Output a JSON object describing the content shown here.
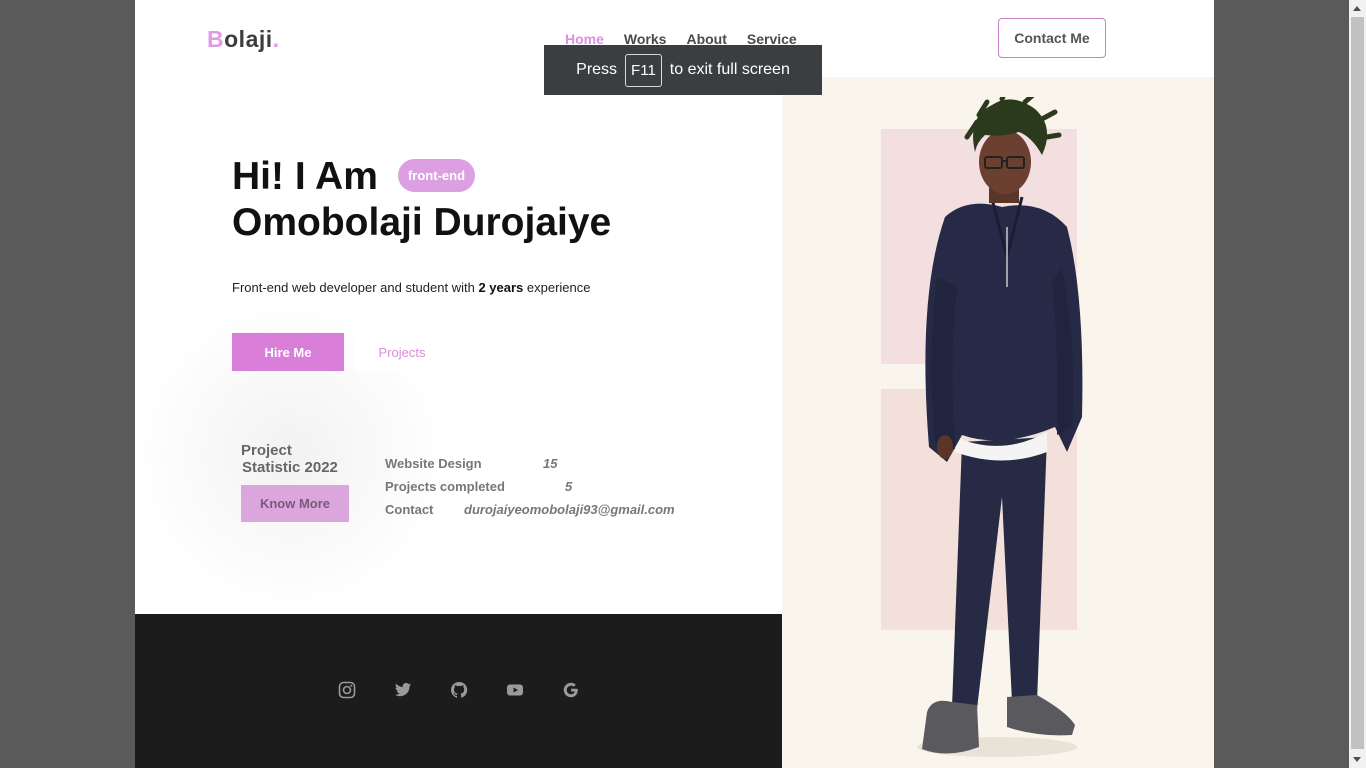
{
  "header": {
    "logo_first": "B",
    "logo_rest": "olaji",
    "logo_dot": ".",
    "nav": [
      "Home",
      "Works",
      "About",
      "Service"
    ],
    "contact_button": "Contact Me"
  },
  "hero": {
    "line1": "Hi! I Am",
    "line2": "Omobolaji Durojaiye",
    "badge": "front-end",
    "subtitle_pre": "Front-end web developer and student with ",
    "subtitle_bold": "2 years",
    "subtitle_post": " experience",
    "hire_button": "Hire Me",
    "projects_button": "Projects"
  },
  "stats": {
    "title_line1": "Project",
    "title_line2": "Statistic 2022",
    "know_more": "Know More",
    "rows": [
      {
        "label": "Website Design",
        "value": "15"
      },
      {
        "label": "Projects completed",
        "value": "5"
      },
      {
        "label": "Contact",
        "value": "durojaiyeomobolaji93@gmail.com"
      }
    ]
  },
  "footer": {
    "icons": [
      "instagram-icon",
      "twitter-icon",
      "github-icon",
      "youtube-icon",
      "google-icon"
    ]
  },
  "toast": {
    "press": "Press",
    "key": "F11",
    "rest": "to exit full screen"
  },
  "colors": {
    "accent": "#d97ed9",
    "footer_bg": "#1c1c1c",
    "right_pane_bg": "#faf5ec"
  }
}
